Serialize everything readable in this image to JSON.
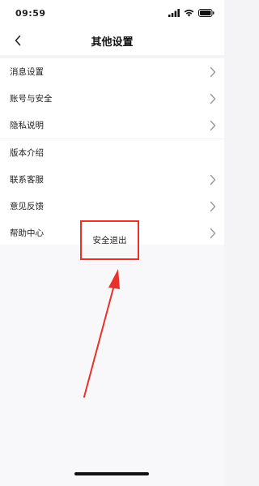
{
  "status_bar": {
    "time": "09:59",
    "icons": [
      "signal-icon",
      "wifi-icon",
      "battery-icon"
    ]
  },
  "nav": {
    "back_icon": "chevron-left-icon",
    "title": "其他设置"
  },
  "group1": {
    "items": [
      {
        "label": "消息设置",
        "has_chevron": true
      },
      {
        "label": "账号与安全",
        "has_chevron": true
      },
      {
        "label": "隐私说明",
        "has_chevron": true
      }
    ]
  },
  "group2": {
    "items": [
      {
        "label": "版本介绍",
        "has_chevron": false
      },
      {
        "label": "联系客服",
        "has_chevron": true
      },
      {
        "label": "意见反馈",
        "has_chevron": true
      },
      {
        "label": "帮助中心",
        "has_chevron": true
      }
    ]
  },
  "logout": {
    "label": "安全退出"
  },
  "colors": {
    "highlight": "#e8312a",
    "arrow": "#e8312a",
    "background": "#f4f4f6"
  }
}
